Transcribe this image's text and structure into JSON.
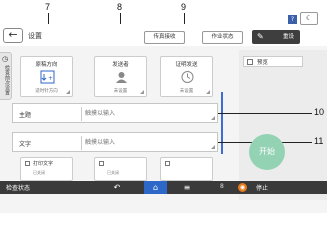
{
  "callouts": [
    "7",
    "8",
    "9",
    "10",
    "11"
  ],
  "header": {
    "back_icon": "arrow-left-icon",
    "title": "设置",
    "buttons": [
      "传真接收",
      "作业状态"
    ],
    "settings_label": "重设",
    "help_label": "?",
    "moon_icon": "moon-icon"
  },
  "side_tab": {
    "icon": "clock-icon",
    "label": "检查前次设置"
  },
  "tiles": [
    {
      "label": "原稿方向",
      "sub": "适时针方向",
      "icon": "orientation-icon"
    },
    {
      "label": "发送者",
      "sub": "未设置",
      "icon": "sender-icon"
    },
    {
      "label": "证明发送",
      "sub": "未设置",
      "icon": "clock-icon"
    }
  ],
  "right_panel": {
    "checkbox_label": "预览",
    "checkbox_checked": false
  },
  "fields": {
    "subject": {
      "label": "主题",
      "placeholder": "触摸以输入"
    },
    "text": {
      "label": "文字",
      "placeholder": "触摸以输入"
    }
  },
  "start_button": "开始",
  "bottom_tiles": [
    {
      "label": "打印文字",
      "sub": "已关闭"
    },
    {
      "label": "",
      "sub": "已关闭"
    },
    {
      "label": "",
      "sub": ""
    }
  ],
  "status_bar": {
    "label": "检查状态",
    "back_icon": "back-arrow-icon",
    "home_icon": "home-icon",
    "menu_icon": "menu-icon",
    "num": "8",
    "stop_label": "停止"
  }
}
